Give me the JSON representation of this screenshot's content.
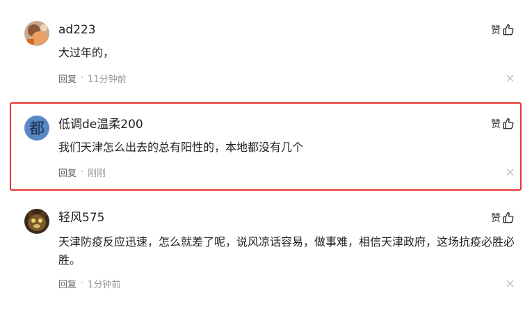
{
  "comments": [
    {
      "avatar_icon": "avatar-photo-icon",
      "username": "ad223",
      "like_label": "赞",
      "content": "大过年的，",
      "reply_label": "回复",
      "separator": "·",
      "time": "11分钟前"
    },
    {
      "avatar_icon": "avatar-calligraphy-icon",
      "avatar_text": "都",
      "username": "低调de温柔200",
      "like_label": "赞",
      "content": "我们天津怎么出去的总有阳性的，本地都没有几个",
      "reply_label": "回复",
      "separator": "·",
      "time": "刚刚",
      "highlighted": true,
      "highlight_color": "#e8322c"
    },
    {
      "avatar_icon": "avatar-photo-icon",
      "username": "轻风575",
      "like_label": "赞",
      "content": "天津防疫反应迅速，怎么就差了呢，说风凉话容易，做事难，相信天津政府，这场抗疫必胜必胜。",
      "reply_label": "回复",
      "separator": "·",
      "time": "1分钟前"
    }
  ],
  "icons": {
    "like": "thumbs-up-icon",
    "close": "close-icon"
  }
}
